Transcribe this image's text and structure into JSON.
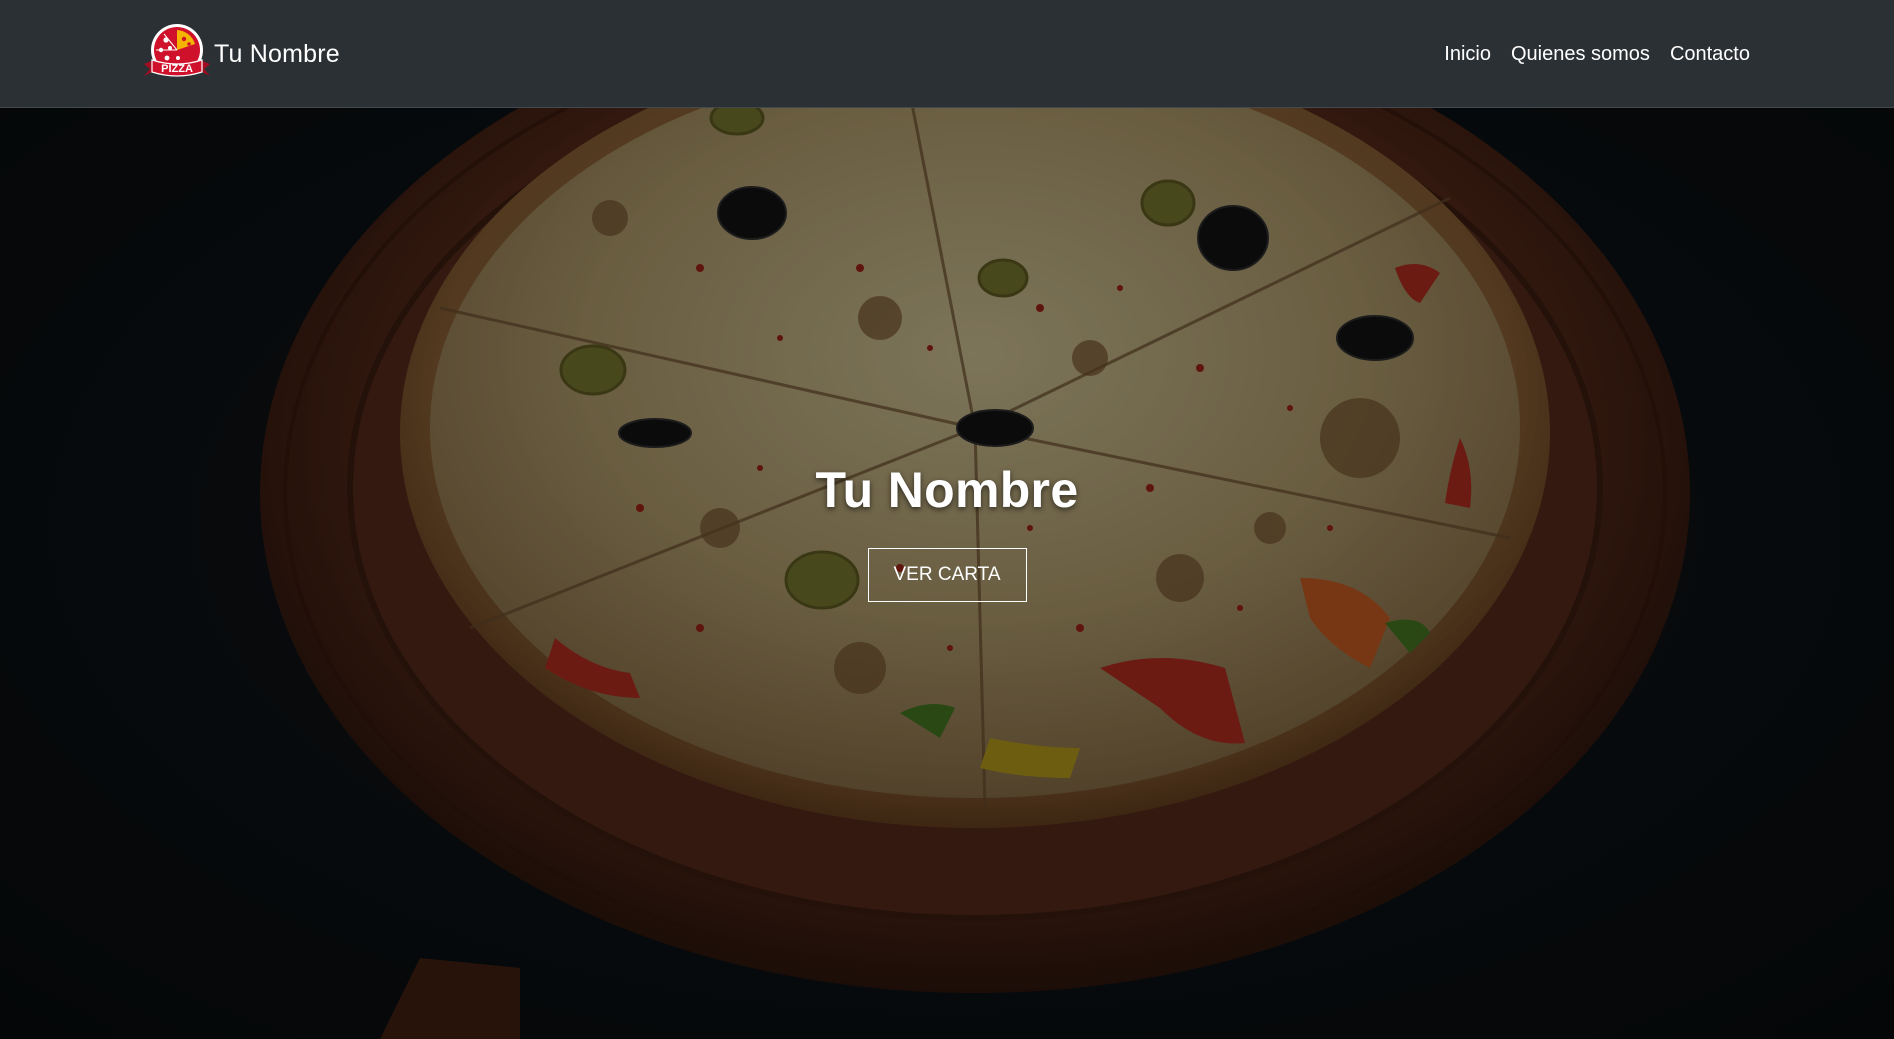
{
  "navbar": {
    "brand_name": "Tu Nombre",
    "logo_text": "PIZZA",
    "links": [
      "Inicio",
      "Quienes somos",
      "Contacto"
    ]
  },
  "hero": {
    "title": "Tu Nombre",
    "button_label": "VER CARTA"
  },
  "colors": {
    "navbar_bg": "#2b3035",
    "logo_red": "#d0112b",
    "logo_yellow": "#f4b400",
    "text": "#ffffff"
  }
}
